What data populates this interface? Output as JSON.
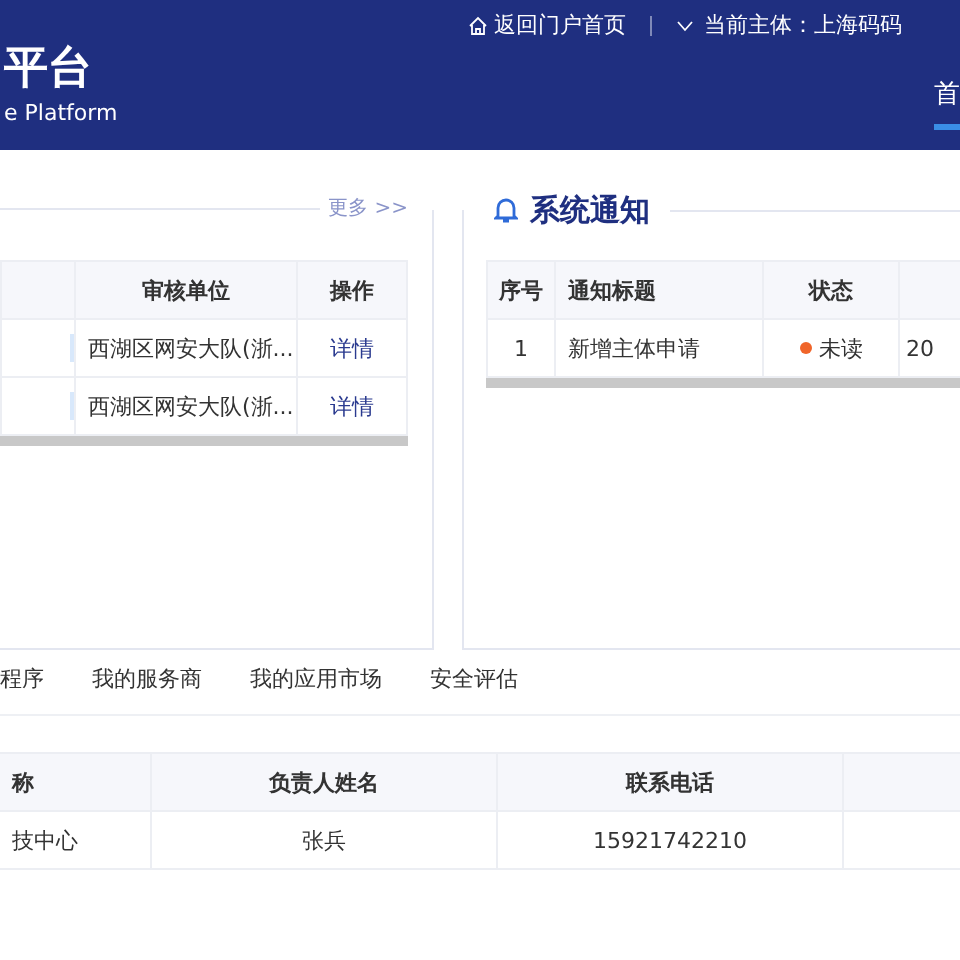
{
  "header": {
    "title": "平台",
    "subtitle": "e Platform",
    "home_link": "返回门户首页",
    "current_entity": "当前主体：上海码码",
    "nav": [
      {
        "label": "首",
        "selected": true
      }
    ]
  },
  "audit_panel": {
    "more": "更多 >>",
    "table": {
      "columns": [
        "",
        "审核单位",
        "操作"
      ],
      "rows": [
        {
          "unit": "西湖区网安大队(浙...",
          "action": "详情"
        },
        {
          "unit": "西湖区网安大队(浙...",
          "action": "详情"
        }
      ]
    }
  },
  "notice_panel": {
    "title": "系统通知",
    "table": {
      "columns": [
        "序号",
        "通知标题",
        "状态",
        ""
      ],
      "rows": [
        {
          "index": "1",
          "title": "新增主体申请",
          "status": "未读",
          "color": "#f0652a",
          "column_4": "20"
        }
      ]
    }
  },
  "tabs": [
    {
      "label": "程序",
      "selected": false
    },
    {
      "label": "我的服务商",
      "selected": false
    },
    {
      "label": "我的应用市场",
      "selected": false
    },
    {
      "label": "安全评估",
      "selected": false
    }
  ],
  "contact_table": {
    "columns": [
      "称",
      "负责人姓名",
      "联系电话",
      ""
    ],
    "rows": [
      {
        "name": "技中心",
        "person": "张兵",
        "phone": "15921742210"
      }
    ]
  }
}
